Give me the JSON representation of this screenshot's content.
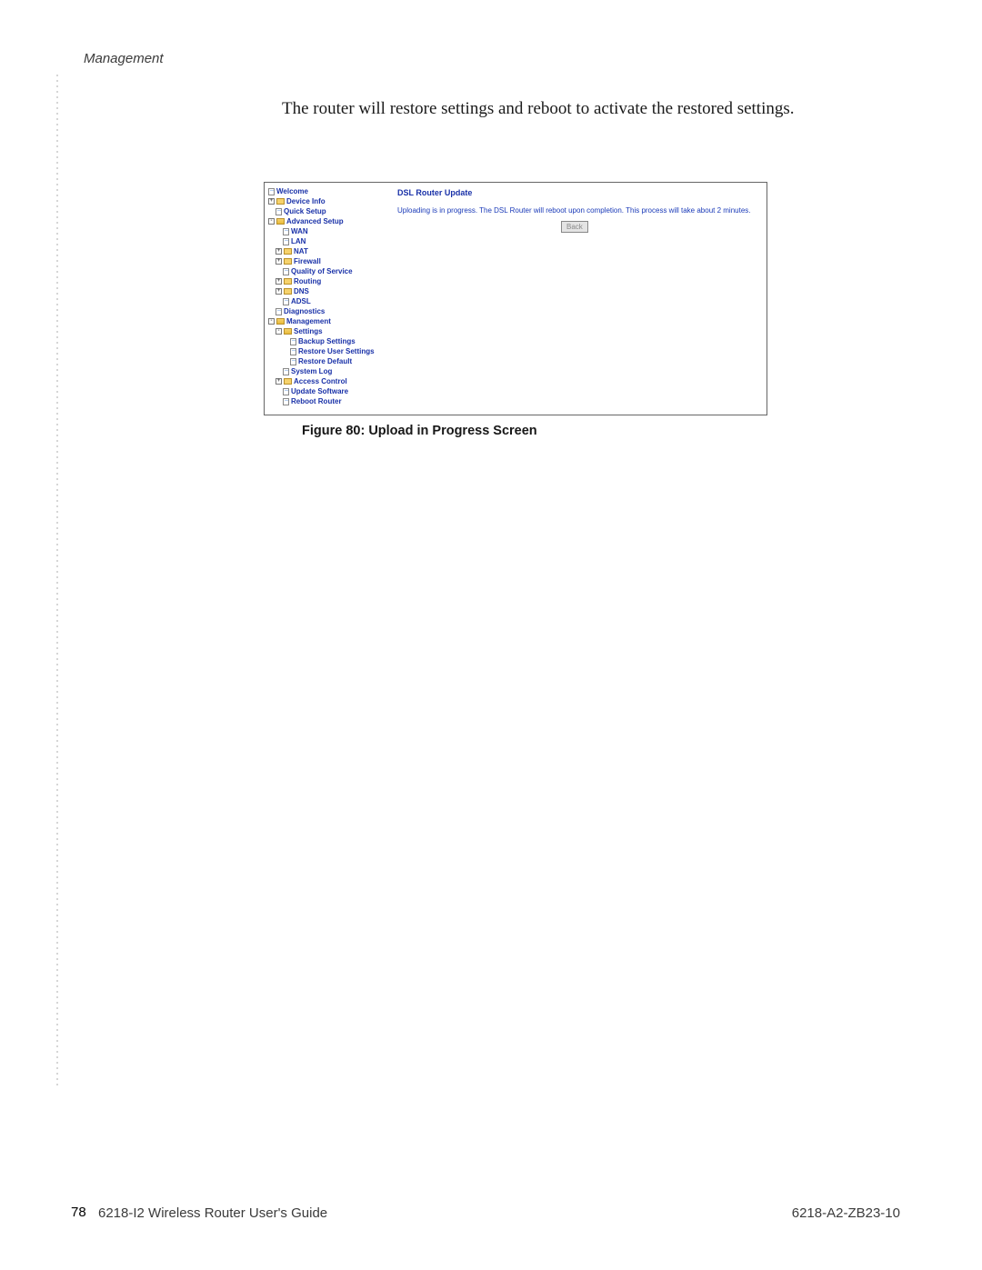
{
  "header": {
    "section": "Management"
  },
  "intro": "The router will restore settings and reboot to activate the restored settings.",
  "tree": {
    "welcome": "Welcome",
    "device_info": "Device Info",
    "quick_setup": "Quick Setup",
    "advanced_setup": "Advanced Setup",
    "wan": "WAN",
    "lan": "LAN",
    "nat": "NAT",
    "firewall": "Firewall",
    "qos": "Quality of Service",
    "routing": "Routing",
    "dns": "DNS",
    "adsl": "ADSL",
    "diagnostics": "Diagnostics",
    "management": "Management",
    "settings": "Settings",
    "backup_settings": "Backup Settings",
    "restore_user_settings": "Restore User Settings",
    "restore_default": "Restore Default",
    "system_log": "System Log",
    "access_control": "Access Control",
    "update_software": "Update Software",
    "reboot_router": "Reboot Router"
  },
  "content": {
    "title": "DSL Router Update",
    "message": "Uploading is in progress. The DSL Router will reboot upon completion. This process will take about 2 minutes.",
    "back_label": "Back"
  },
  "caption": "Figure 80: Upload in Progress Screen",
  "footer": {
    "page_number": "78",
    "guide": "6218-I2 Wireless Router User's Guide",
    "doc_id": "6218-A2-ZB23-10"
  }
}
